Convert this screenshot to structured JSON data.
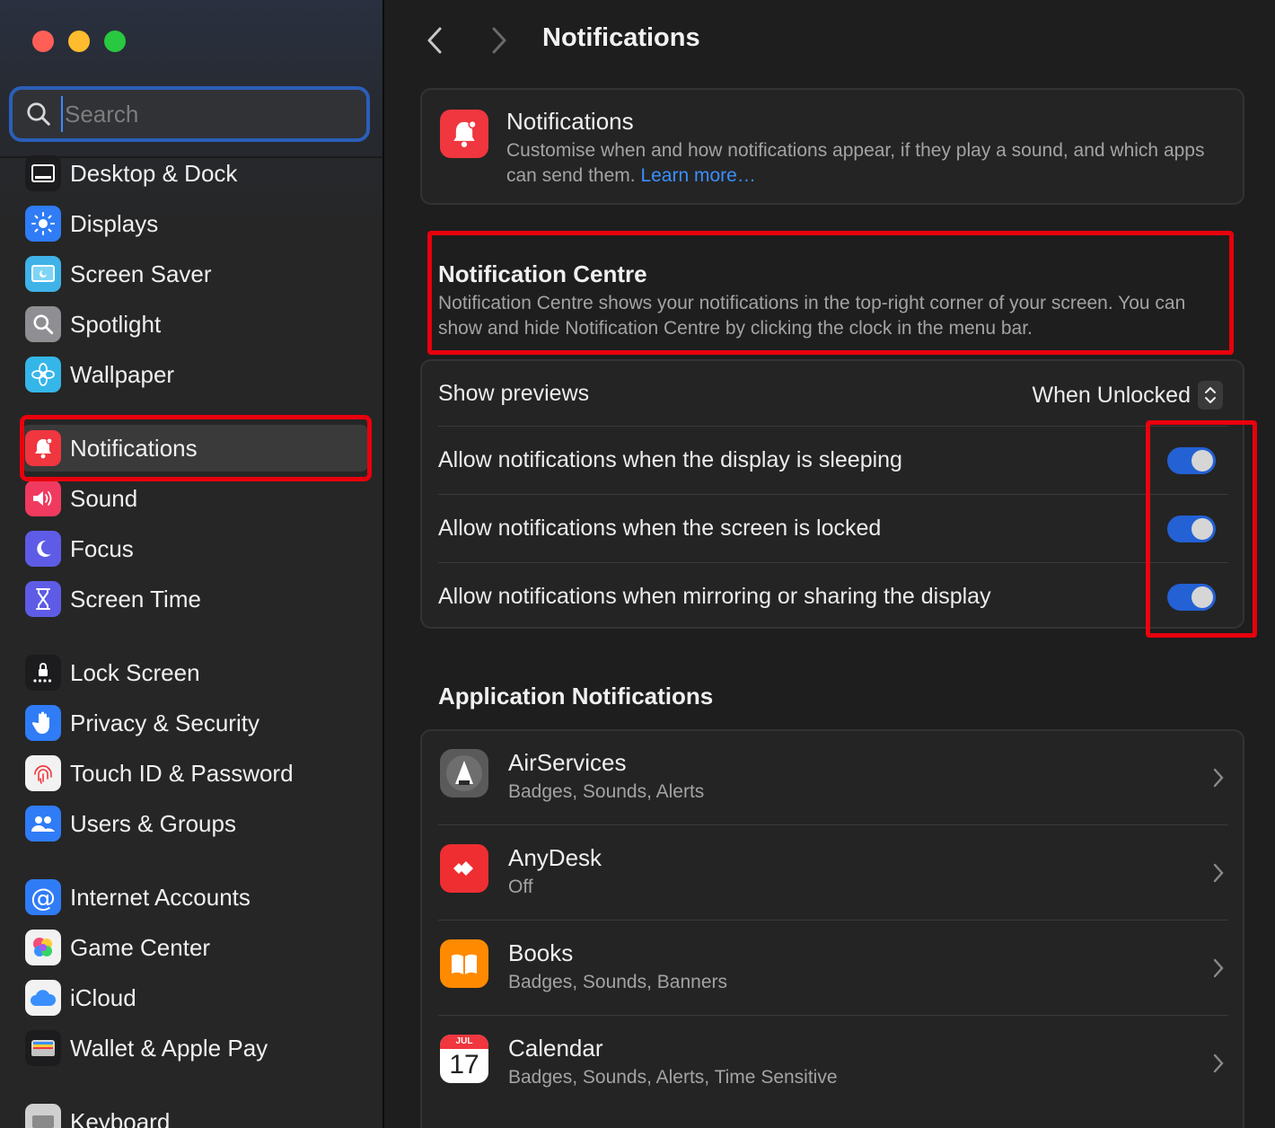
{
  "sidebar": {
    "search_placeholder": "Search",
    "items": [
      {
        "label": "Desktop & Dock",
        "icon": "dock-icon",
        "color": "#1c1c1e"
      },
      {
        "label": "Displays",
        "icon": "sun-icon",
        "color": "#2f7cf6"
      },
      {
        "label": "Screen Saver",
        "icon": "screen-saver-icon",
        "color": "#3fb3e8"
      },
      {
        "label": "Spotlight",
        "icon": "magnifier-icon",
        "color": "#8e8e93"
      },
      {
        "label": "Wallpaper",
        "icon": "flower-icon",
        "color": "#35b6e9"
      },
      {
        "label": "Notifications",
        "icon": "bell-icon",
        "color": "#f0363e"
      },
      {
        "label": "Sound",
        "icon": "speaker-icon",
        "color": "#f03a5f"
      },
      {
        "label": "Focus",
        "icon": "moon-icon",
        "color": "#5e5ce6"
      },
      {
        "label": "Screen Time",
        "icon": "hourglass-icon",
        "color": "#5e5ce6"
      },
      {
        "label": "Lock Screen",
        "icon": "lock-icon",
        "color": "#1c1c1e"
      },
      {
        "label": "Privacy & Security",
        "icon": "hand-icon",
        "color": "#2f7cf6"
      },
      {
        "label": "Touch ID & Password",
        "icon": "fingerprint-icon",
        "color": "#f2f2f2"
      },
      {
        "label": "Users & Groups",
        "icon": "users-icon",
        "color": "#2f7cf6"
      },
      {
        "label": "Internet Accounts",
        "icon": "at-icon",
        "color": "#2f7cf6"
      },
      {
        "label": "Game Center",
        "icon": "game-center-icon",
        "color": "#f2f2f2"
      },
      {
        "label": "iCloud",
        "icon": "cloud-icon",
        "color": "#f2f2f2"
      },
      {
        "label": "Wallet & Apple Pay",
        "icon": "wallet-icon",
        "color": "#1c1c1e"
      },
      {
        "label": "Keyboard",
        "icon": "keyboard-icon",
        "color": "#d0d0d0"
      }
    ]
  },
  "header": {
    "title": "Notifications"
  },
  "intro": {
    "title": "Notifications",
    "description": "Customise when and how notifications appear, if they play a sound, and which apps can send them.",
    "link": "Learn more…"
  },
  "notification_centre": {
    "title": "Notification Centre",
    "description": "Notification Centre shows your notifications in the top-right corner of your screen. You can show and hide Notification Centre by clicking the clock in the menu bar."
  },
  "settings": {
    "show_previews_label": "Show previews",
    "show_previews_value": "When Unlocked",
    "toggles": [
      {
        "label": "Allow notifications when the display is sleeping",
        "on": true
      },
      {
        "label": "Allow notifications when the screen is locked",
        "on": true
      },
      {
        "label": "Allow notifications when mirroring or sharing the display",
        "on": true
      }
    ]
  },
  "apps": {
    "heading": "Application Notifications",
    "list": [
      {
        "name": "AirServices",
        "detail": "Badges, Sounds, Alerts",
        "icon": "airservices-icon"
      },
      {
        "name": "AnyDesk",
        "detail": "Off",
        "icon": "anydesk-icon"
      },
      {
        "name": "Books",
        "detail": "Badges, Sounds, Banners",
        "icon": "books-icon"
      },
      {
        "name": "Calendar",
        "detail": "Badges, Sounds, Alerts, Time Sensitive",
        "icon": "calendar-icon",
        "cal_month": "JUL",
        "cal_day": "17"
      }
    ]
  },
  "colors": {
    "accent": "#2361d4",
    "highlight": "#e8000d",
    "link": "#3a8fff"
  }
}
